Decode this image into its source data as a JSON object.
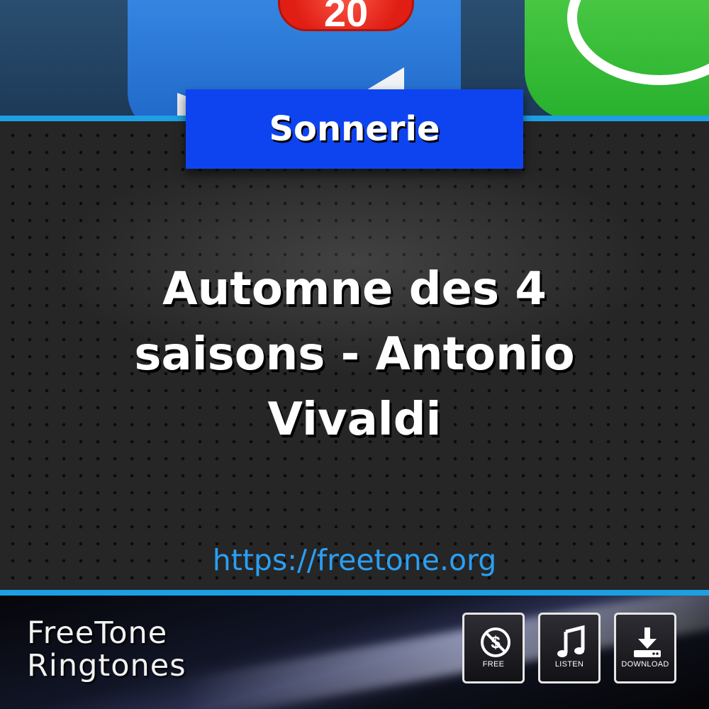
{
  "top_banner": {
    "badge_count": "20"
  },
  "category": "Sonnerie",
  "ringtone": {
    "title": "Automne des 4 saisons - Antonio Vivaldi"
  },
  "site_url": "https://freetone.org",
  "brand": {
    "line1": "FreeTone",
    "line2": "Ringtones"
  },
  "features": [
    {
      "label": "FREE",
      "icon": "no-dollar-icon"
    },
    {
      "label": "LISTEN",
      "icon": "music-note-icon"
    },
    {
      "label": "DOWNLOAD",
      "icon": "download-icon"
    }
  ],
  "colors": {
    "accent_blue": "#0e44f0",
    "line_blue": "#1d9fe4",
    "url_blue": "#2b9ff3"
  }
}
